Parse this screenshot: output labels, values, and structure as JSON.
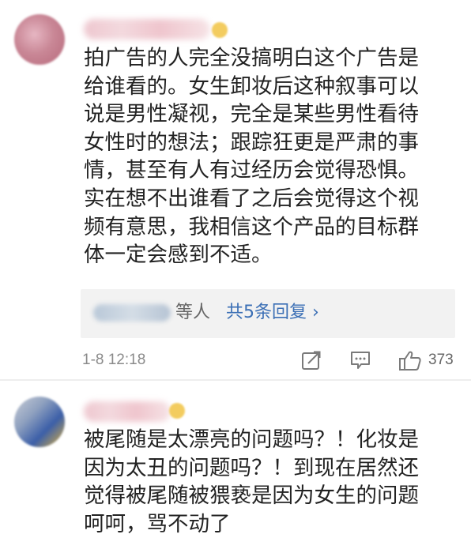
{
  "comments": [
    {
      "text": "拍广告的人完全没搞明白这个广告是\n给谁看的。女生卸妆后这种叙事可以\n说是男性凝视，完全是某些男性看待\n女性时的想法；跟踪狂更是严肃的事\n情，甚至有人有过经历会觉得恐惧。\n实在想不出谁看了之后会觉得这个视\n频有意思，我相信这个产品的目标群\n体一定会感到不适。",
      "replies_suffix": "等人",
      "replies_link": "共5条回复 ›",
      "time": "1-8 12:18",
      "likes": "373"
    },
    {
      "text": "被尾随是太漂亮的问题吗？！化妆是\n因为太丑的问题吗？！到现在居然还\n觉得被尾随被猥亵是因为女生的问题\n呵呵，骂不动了"
    }
  ],
  "icons": {
    "share": "share-icon",
    "comment": "comment-icon",
    "like": "thumbs-up-icon"
  },
  "colors": {
    "text": "#222222",
    "link": "#3b6fb5",
    "meta": "#8a8a8a",
    "reply_bg": "#f2f2f2"
  }
}
